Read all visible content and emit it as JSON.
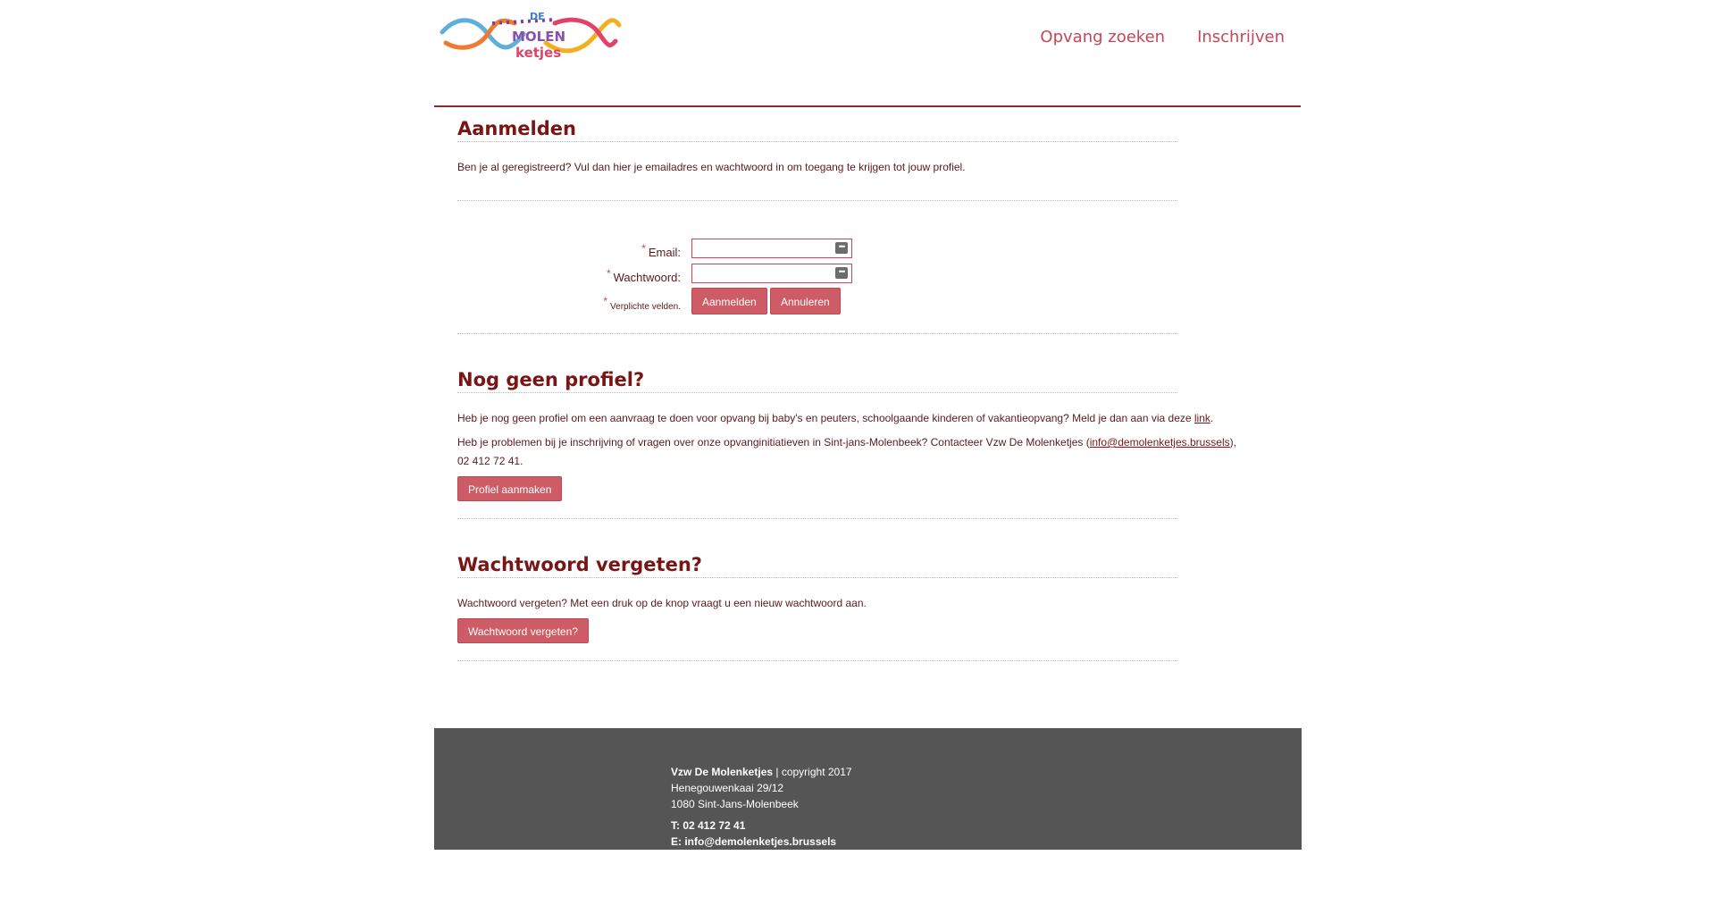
{
  "brand": {
    "logo_text": [
      "DE",
      "MOLEN",
      "ketjes"
    ]
  },
  "nav": {
    "items": [
      "Opvang zoeken",
      "Inschrijven"
    ]
  },
  "login": {
    "title": "Aanmelden",
    "intro": "Ben je al geregistreerd? Vul dan hier je emailadres en wachtwoord in om toegang te krijgen tot jouw profiel.",
    "required_mark": "*",
    "email_label": "Email:",
    "email_value": "",
    "password_label": "Wachtwoord:",
    "password_value": "",
    "required_note": "Verplichte velden.",
    "submit_label": "Aanmelden",
    "cancel_label": "Annuleren",
    "field_icon": "password-manager-icon"
  },
  "register": {
    "title": "Nog geen profiel?",
    "text1_before": "Heb je nog geen profiel om een aanvraag te doen voor opvang bij baby's en peuters, schoolgaande kinderen of vakantieopvang? Meld je dan aan via deze ",
    "text1_link": "link",
    "text1_after": ".",
    "text2_before": "Heb je problemen bij je inschrijving of vragen over onze opvanginitiatieven in Sint-jans-Molenbeek? Contacteer Vzw De Molenketjes (",
    "text2_link": "info@demolenketjes.brussels",
    "text2_after": "),",
    "text2_phone": "02 412 72 41.",
    "button_label": "Profiel aanmaken"
  },
  "forgot": {
    "title": "Wachtwoord vergeten?",
    "text": "Wachtwoord vergeten? Met een druk op de knop vraagt u een nieuw wachtwoord aan.",
    "button_label": "Wachtwoord vergeten?"
  },
  "footer": {
    "org": "Vzw De Molenketjes",
    "copyright": " | copyright 2017",
    "address1": "Henegouwenkaai 29/12",
    "address2": "1080 Sint-Jans-Molenbeek",
    "phone": "T: 02 412 72 41",
    "email": "E: info@demolenketjes.brussels"
  },
  "colors": {
    "accent": "#c8455a",
    "heading": "#7a1515",
    "button": "#cd5c66",
    "footer_bg": "#555555"
  }
}
